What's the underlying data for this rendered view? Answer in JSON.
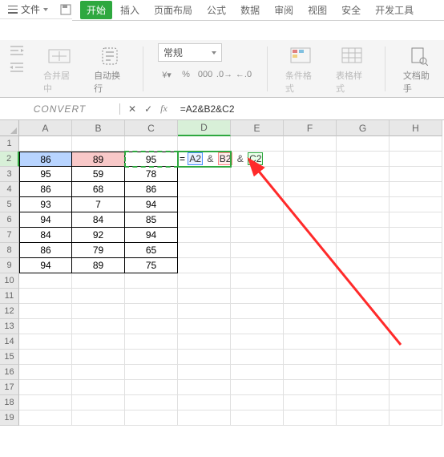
{
  "menu": {
    "file": "文件"
  },
  "tabs": {
    "start": "开始",
    "insert": "插入",
    "layout": "页面布局",
    "formula": "公式",
    "data": "数据",
    "review": "审阅",
    "view": "视图",
    "security": "安全",
    "dev": "开发工具"
  },
  "ribbon": {
    "merge": "合并居中",
    "wrap": "自动换行",
    "num_format": "常规",
    "cond_format": "条件格式",
    "table_style": "表格样式",
    "doc_helper": "文档助手"
  },
  "namebox": "CONVERT",
  "formula": "=A2&B2&C2",
  "fx": "fx",
  "edit_formula": {
    "eq": "=",
    "a": "A2",
    "b": "B2",
    "c": "C2",
    "amp": "&"
  },
  "cols": [
    "A",
    "B",
    "C",
    "D",
    "E",
    "F",
    "G",
    "H"
  ],
  "rows": [
    "1",
    "2",
    "3",
    "4",
    "5",
    "6",
    "7",
    "8",
    "9",
    "10",
    "11",
    "12",
    "13",
    "14",
    "15",
    "16",
    "17",
    "18",
    "19"
  ],
  "grid": {
    "A2": "86",
    "B2": "89",
    "C2": "95",
    "A3": "95",
    "B3": "59",
    "C3": "78",
    "A4": "86",
    "B4": "68",
    "C4": "86",
    "A5": "93",
    "B5": "7",
    "C5": "94",
    "A6": "94",
    "B6": "84",
    "C6": "85",
    "A7": "84",
    "B7": "92",
    "C7": "94",
    "A8": "86",
    "B8": "79",
    "C8": "65",
    "A9": "94",
    "B9": "89",
    "C9": "75"
  },
  "chart_data": {
    "type": "table",
    "columns": [
      "A",
      "B",
      "C"
    ],
    "rows": [
      [
        86,
        89,
        95
      ],
      [
        95,
        59,
        78
      ],
      [
        86,
        68,
        86
      ],
      [
        93,
        7,
        94
      ],
      [
        94,
        84,
        85
      ],
      [
        84,
        92,
        94
      ],
      [
        86,
        79,
        65
      ],
      [
        94,
        89,
        75
      ]
    ]
  }
}
